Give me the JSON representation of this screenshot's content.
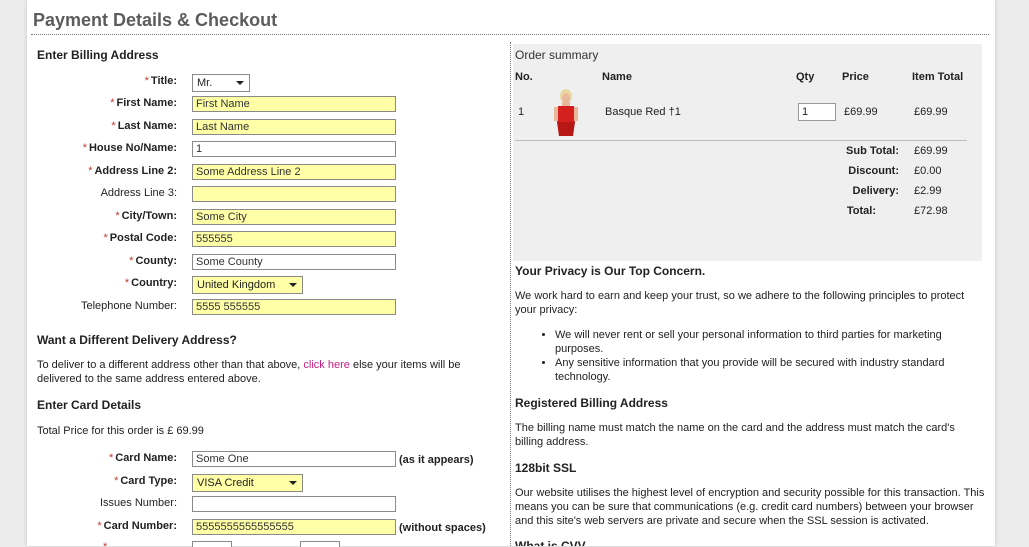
{
  "page": {
    "title": "Payment Details & Checkout"
  },
  "billing": {
    "heading": "Enter Billing Address",
    "fields": [
      {
        "label": "Title:",
        "required": "*",
        "value": "Mr."
      },
      {
        "label": "First Name:",
        "required": "*",
        "value": "First Name"
      },
      {
        "label": "Last Name:",
        "required": "*",
        "value": "Last Name"
      },
      {
        "label": "House No/Name:",
        "required": "*",
        "value": "1"
      },
      {
        "label": "Address Line 2:",
        "required": "*",
        "value": "Some Address Line 2"
      },
      {
        "label": "Address Line 3:",
        "required": "",
        "value": ""
      },
      {
        "label": "City/Town:",
        "required": "*",
        "value": "Some City"
      },
      {
        "label": "Postal Code:",
        "required": "*",
        "value": "555555"
      },
      {
        "label": "County:",
        "required": "*",
        "value": "Some County"
      },
      {
        "label": "Country:",
        "required": "*",
        "value": "United Kingdom"
      },
      {
        "label": "Telephone Number:",
        "required": "",
        "value": "5555 555555"
      }
    ]
  },
  "delivery": {
    "heading": "Want a Different Delivery Address?",
    "text_before": "To deliver to a different address other than that above, ",
    "link": "click here",
    "text_after": " else your items will be delivered to the same address entered above."
  },
  "card": {
    "heading": "Enter Card Details",
    "total_text": "Total Price for this order is £ 69.99",
    "fields": [
      {
        "label": "Card Name:",
        "required": "*",
        "value": "Some One",
        "note": "(as it appears)"
      },
      {
        "label": "Card Type:",
        "required": "*",
        "value": "VISA Credit",
        "note": ""
      },
      {
        "label": "Issues Number:",
        "required": "",
        "value": "",
        "note": ""
      },
      {
        "label": "Card Number:",
        "required": "*",
        "value": "5555555555555555",
        "note": "(without spaces)"
      }
    ]
  },
  "order": {
    "heading": "Order summary",
    "columns": [
      "No.",
      "Name",
      "Qty",
      "Price",
      "Item Total"
    ],
    "item": {
      "no": "1",
      "name": "Basque Red †1",
      "qty": "1",
      "price": "£69.99",
      "total": "£69.99"
    },
    "totals": [
      {
        "label": "Sub Total:",
        "value": "£69.99"
      },
      {
        "label": "Discount:",
        "value": "£0.00"
      },
      {
        "label": "Delivery:",
        "value": "£2.99"
      },
      {
        "label": "Total:",
        "value": "£72.98"
      }
    ]
  },
  "info": {
    "privacy_heading": "Your Privacy is Our Top Concern.",
    "privacy_text": "We work hard to earn and keep your trust, so we adhere to the following principles to protect your privacy:",
    "bullets": [
      "We will never rent or sell your personal information to third parties for marketing purposes.",
      "Any sensitive information that you provide will be secured with industry standard technology."
    ],
    "registered_heading": "Registered Billing Address",
    "registered_text": "The billing name must match the name on the card and the address must match the card's billing address.",
    "ssl_heading": "128bit SSL",
    "ssl_text": "Our website utilises the highest level of encryption and security possible for this transaction. This means you can be sure that communications (e.g. credit card numbers) between your browser and this site's web servers are private and secure when the SSL session is activated.",
    "cvv_heading": "What is CVV"
  },
  "colors": {
    "highlight_field": "#ffffa8",
    "link": "#c61e84",
    "required": "#c0392b"
  }
}
